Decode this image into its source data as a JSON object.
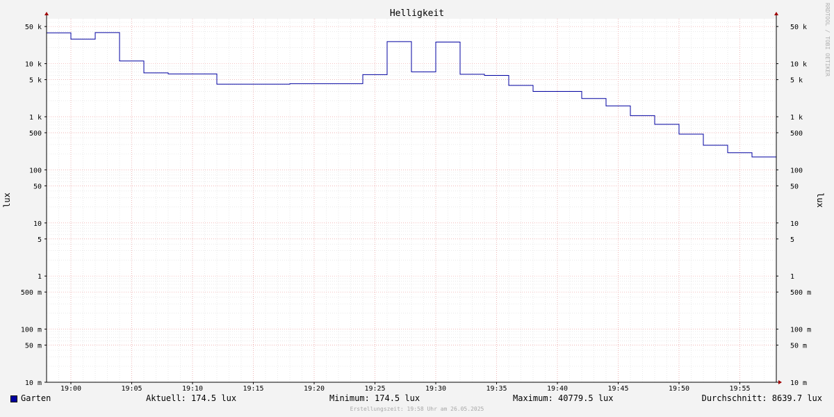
{
  "chart_data": {
    "type": "line",
    "title": "Helligkeit",
    "ylabel": "lux",
    "y_scale": "log",
    "ylim": [
      0.01,
      70000
    ],
    "xlim": [
      "18:58",
      "19:58"
    ],
    "x_ticks": [
      "19:00",
      "19:05",
      "19:10",
      "19:15",
      "19:20",
      "19:25",
      "19:30",
      "19:35",
      "19:40",
      "19:45",
      "19:50",
      "19:55"
    ],
    "y_ticks": [
      {
        "value": 50000,
        "label": "50 k"
      },
      {
        "value": 10000,
        "label": "10 k"
      },
      {
        "value": 5000,
        "label": "5 k"
      },
      {
        "value": 1000,
        "label": "1 k"
      },
      {
        "value": 500,
        "label": "500"
      },
      {
        "value": 100,
        "label": "100"
      },
      {
        "value": 50,
        "label": "50"
      },
      {
        "value": 10,
        "label": "10"
      },
      {
        "value": 5,
        "label": "5"
      },
      {
        "value": 1,
        "label": "1"
      },
      {
        "value": 0.5,
        "label": "500 m"
      },
      {
        "value": 0.1,
        "label": "100 m"
      },
      {
        "value": 0.05,
        "label": "50 m"
      },
      {
        "value": 0.01,
        "label": "10 m"
      }
    ],
    "grid": true,
    "series": [
      {
        "name": "Garten",
        "color": "#0000a0",
        "step": true,
        "points": [
          {
            "x": "18:58",
            "y": 38000
          },
          {
            "x": "19:00",
            "y": 29000
          },
          {
            "x": "19:02",
            "y": 38500
          },
          {
            "x": "19:04",
            "y": 11200
          },
          {
            "x": "19:06",
            "y": 6700
          },
          {
            "x": "19:08",
            "y": 6400
          },
          {
            "x": "19:12",
            "y": 4100
          },
          {
            "x": "19:18",
            "y": 4200
          },
          {
            "x": "19:24",
            "y": 6200
          },
          {
            "x": "19:26",
            "y": 26000
          },
          {
            "x": "19:28",
            "y": 7000
          },
          {
            "x": "19:30",
            "y": 25500
          },
          {
            "x": "19:32",
            "y": 6300
          },
          {
            "x": "19:34",
            "y": 6000
          },
          {
            "x": "19:36",
            "y": 3900
          },
          {
            "x": "19:38",
            "y": 3000
          },
          {
            "x": "19:42",
            "y": 2200
          },
          {
            "x": "19:44",
            "y": 1600
          },
          {
            "x": "19:46",
            "y": 1050
          },
          {
            "x": "19:48",
            "y": 720
          },
          {
            "x": "19:50",
            "y": 470
          },
          {
            "x": "19:52",
            "y": 290
          },
          {
            "x": "19:54",
            "y": 210
          },
          {
            "x": "19:56",
            "y": 174.5
          }
        ]
      }
    ]
  },
  "legend": {
    "series_name": "Garten",
    "current": "Aktuell: 174.5 lux",
    "minimum": "Minimum: 174.5 lux",
    "maximum": "Maximum: 40779.5 lux",
    "average": "Durchschnitt: 8639.7 lux"
  },
  "watermark": "RRDTOOL / TOBI OETIKER",
  "footer": "Erstellungszeit: 19:58 Uhr am 26.05.2025"
}
